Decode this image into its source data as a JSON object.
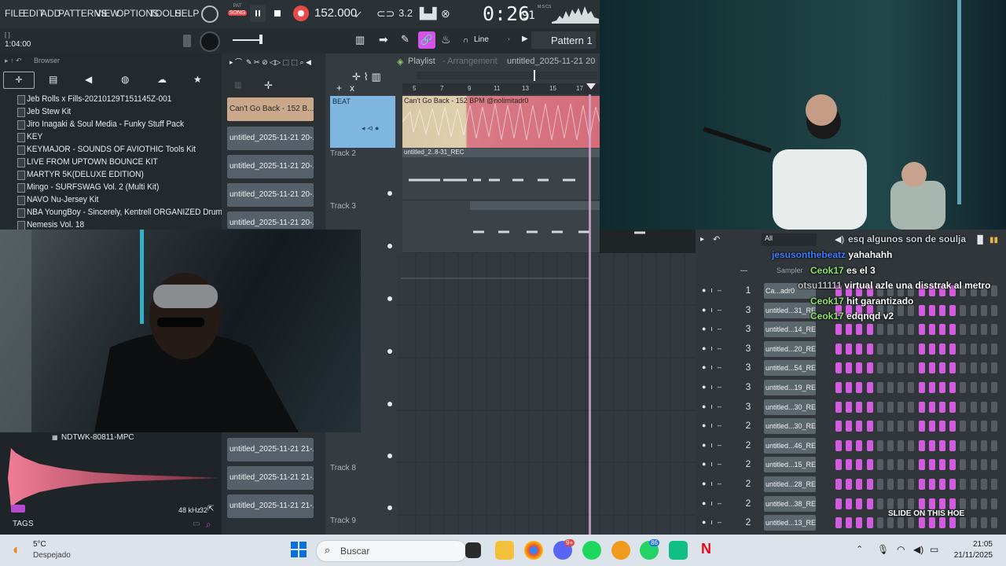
{
  "menu": [
    "FILE",
    "EDIT",
    "ADD",
    "PATTERNS",
    "VIEW",
    "OPTIONS",
    "TOOLS",
    "HELP"
  ],
  "transport": {
    "pat_label": "PAT",
    "song_label": "SONG",
    "tempo": "152.000",
    "time": "0:26",
    "time_small": "91",
    "time_unit": "M:S:CS",
    "position": "1:04:00",
    "snap": "Line",
    "pattern": "Pattern 1"
  },
  "browser": {
    "title": "Browser",
    "items": [
      "Jeb Rolls x Fills-20210129T151145Z-001",
      "Jeb Stew Kit",
      "Jiro Inagaki & Soul Media - Funky Stuff Pack",
      "KEY",
      "KEYMAJOR - SOUNDS OF AVIOTHIC Tools Kit",
      "LIVE FROM UPTOWN BOUNCE KIT",
      "MARTYR 5K(DELUXE EDITION)",
      "Mingo - SURFSWAG Vol. 2 (Multi Kit)",
      "NAVO Nu-Jersey Kit",
      "NBA YoungBoy - Sincerely, Kentrell ORGANIZED Drum Kit",
      "Nemesis Vol. 18"
    ]
  },
  "patterns": [
    "Can't Go Back - 152 B...",
    "untitled_2025-11-21 20-...",
    "untitled_2025-11-21 20-...",
    "untitled_2025-11-21 20-...",
    "untitled_2025-11-21 20-...",
    "untitled_2025-11-21 21-...",
    "untitled_2025-11-21 21-...",
    "untitled_2025-11-21 21-..."
  ],
  "playlist": {
    "title": "Playlist",
    "subtitle": "- Arrangement",
    "project": "untitled_2025-11-21 20",
    "ruler": [
      "5",
      "7",
      "9",
      "11",
      "13",
      "15",
      "17"
    ],
    "tracks": [
      {
        "name": "BEAT",
        "clip": "Can't Go Back - 152 BPM @nolimitadr0"
      },
      {
        "name": "Track 2",
        "clip": "untitled_2..8-31_REC"
      },
      {
        "name": "Track 3",
        "clip": ""
      },
      {
        "name": "Track 8",
        "clip": ""
      },
      {
        "name": "Track 9",
        "clip": ""
      }
    ]
  },
  "sample": {
    "name": "NDTWK-80811-MPC",
    "rate": "48 kHz",
    "bits": "32",
    "tags_label": "TAGS"
  },
  "rack": {
    "filter": "All",
    "sampler_label": "Sampler",
    "dash": "---",
    "rows": [
      {
        "num": "1",
        "name": "Ca...adr0",
        "steps": "1111000011110000"
      },
      {
        "num": "3",
        "name": "untitled...31_REC",
        "steps": "1111000011110000"
      },
      {
        "num": "3",
        "name": "untitled...14_REC",
        "steps": "1111000011110000"
      },
      {
        "num": "3",
        "name": "untitled...20_REC",
        "steps": "1111000011110000"
      },
      {
        "num": "3",
        "name": "untitled...54_REC",
        "steps": "1111000011110000"
      },
      {
        "num": "3",
        "name": "untitled...19_REC",
        "steps": "1111000011110000"
      },
      {
        "num": "3",
        "name": "untitled...30_REC",
        "steps": "1111000011110000"
      },
      {
        "num": "2",
        "name": "untitled...30_REC",
        "steps": "1111000011110000"
      },
      {
        "num": "2",
        "name": "untitled...46_REC",
        "steps": "1111000011110000"
      },
      {
        "num": "2",
        "name": "untitled...15_REC",
        "steps": "1111000011110000"
      },
      {
        "num": "2",
        "name": "untitled...28_REC",
        "steps": "1111000011110000"
      },
      {
        "num": "2",
        "name": "untitled...38_REC",
        "steps": "1111000011110000"
      },
      {
        "num": "2",
        "name": "untitled...13_REC",
        "steps": "1111000011110000"
      }
    ]
  },
  "chat": [
    {
      "user": "",
      "msg": "esq algunos son de soulja",
      "color": "#ffffff"
    },
    {
      "user": "jesusonthebeatz",
      "msg": "yahahahh",
      "color": "#3b7dff"
    },
    {
      "user": "Ceok17",
      "msg": "es el 3",
      "color": "#8ee36a"
    },
    {
      "user": "otsu11111",
      "msg": "virtual azle una disstrak al metro",
      "color": "#b9b9b9"
    },
    {
      "user": "Ceok17",
      "msg": "hit garantizado",
      "color": "#8ee36a"
    },
    {
      "user": "Ceok17",
      "msg": "edqnqd v2",
      "color": "#8ee36a"
    }
  ],
  "overlay_text": "SLIDE ON THIS HOE",
  "taskbar": {
    "temp": "5°C",
    "weather": "Despejado",
    "search": "Buscar",
    "time": "21:05",
    "date": "21/11/2025",
    "badge_discord": "9+",
    "badge_whatsapp": "86"
  }
}
